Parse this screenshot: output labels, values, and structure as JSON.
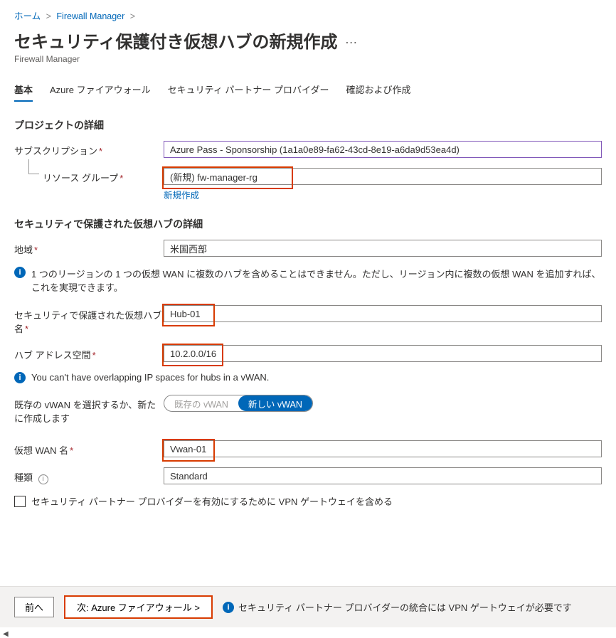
{
  "breadcrumb": {
    "home": "ホーム",
    "fwm": "Firewall Manager"
  },
  "page": {
    "title": "セキュリティ保護付き仮想ハブの新規作成",
    "subtitle": "Firewall Manager"
  },
  "tabs": {
    "basic": "基本",
    "azfw": "Azure ファイアウォール",
    "partner": "セキュリティ パートナー プロバイダー",
    "review": "確認および作成"
  },
  "sections": {
    "project": "プロジェクトの詳細",
    "hub": "セキュリティで保護された仮想ハブの詳細"
  },
  "labels": {
    "subscription": "サブスクリプション",
    "resource_group": "リソース グループ",
    "create_new": "新規作成",
    "region": "地域",
    "hub_name": "セキュリティで保護された仮想ハブ名",
    "hub_addr": "ハブ アドレス空間",
    "vwan_select": "既存の vWAN を選択するか、新たに作成します",
    "vwan_name": "仮想 WAN 名",
    "type": "種類",
    "vpn_checkbox": "セキュリティ パートナー プロバイダーを有効にするために VPN ゲートウェイを含める"
  },
  "values": {
    "subscription": "Azure Pass - Sponsorship (1a1a0e89-fa62-43cd-8e19-a6da9d53ea4d)",
    "resource_group": "(新規) fw-manager-rg",
    "region": "米国西部",
    "hub_name": "Hub-01",
    "hub_addr": "10.2.0.0/16",
    "vwan_existing": "既存の vWAN",
    "vwan_new": "新しい vWAN",
    "vwan_name": "Vwan-01",
    "type": "Standard"
  },
  "info": {
    "region_note": "1 つのリージョンの 1 つの仮想 WAN に複数のハブを含めることはできません。ただし、リージョン内に複数の仮想 WAN を追加すれば、これを実現できます。",
    "ip_note": "You can't have overlapping IP spaces for hubs in a vWAN."
  },
  "footer": {
    "prev": "前へ",
    "next": "次: Azure ファイアウォール >",
    "note": "セキュリティ パートナー プロバイダーの統合には VPN ゲートウェイが必要です"
  }
}
